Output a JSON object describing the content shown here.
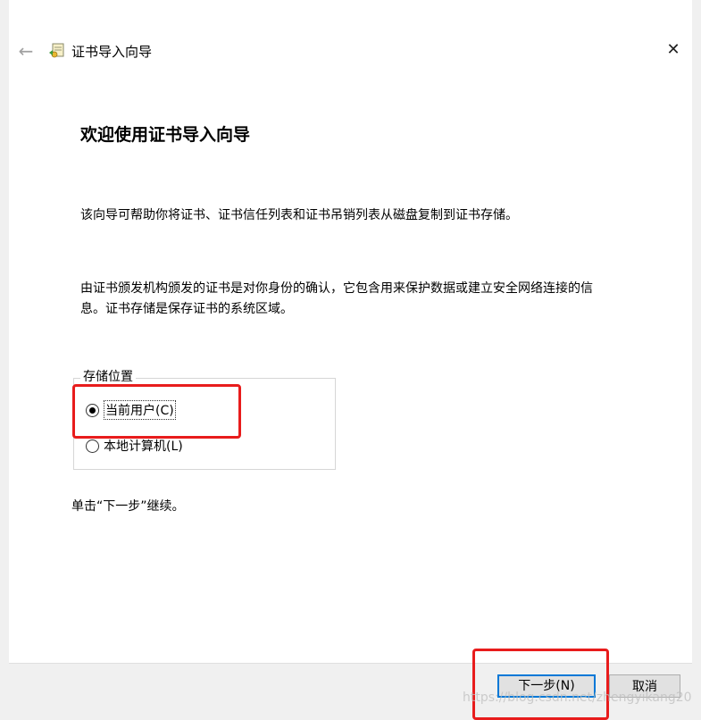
{
  "window": {
    "title": "证书导入向导",
    "back_icon": "←",
    "close_icon": "✕"
  },
  "content": {
    "heading": "欢迎使用证书导入向导",
    "paragraph1": "该向导可帮助你将证书、证书信任列表和证书吊销列表从磁盘复制到证书存储。",
    "paragraph2_line1": "由证书颁发机构颁发的证书是对你身份的确认，它包含用来保护数据或建立安全网络连接的信",
    "paragraph2_line2": "息。证书存储是保存证书的系统区域。",
    "storage_group": {
      "label": "存储位置",
      "options": [
        {
          "label": "当前用户(C)",
          "selected": true
        },
        {
          "label": "本地计算机(L)",
          "selected": false
        }
      ]
    },
    "hint": "单击“下一步”继续。"
  },
  "footer": {
    "next_label": "下一步(N)",
    "cancel_label": "取消"
  },
  "watermark": "https://blog.csdn.net/zhengyikang20",
  "colors": {
    "annotation": "#e81c1c",
    "focus_border": "#0078d7"
  }
}
